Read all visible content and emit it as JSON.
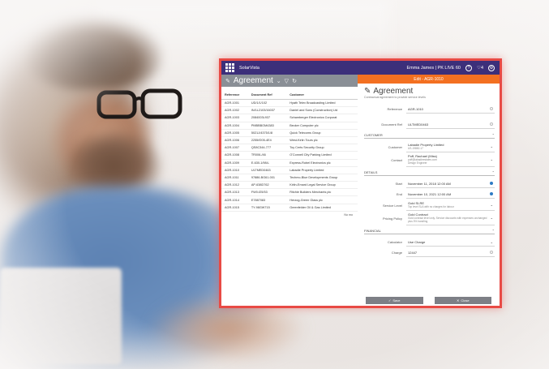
{
  "topbar": {
    "brand": "SolarVista",
    "user": "Emma James | PK LIVE 60",
    "notif_count": "4"
  },
  "list": {
    "title": "Agreement",
    "columns": [
      "Reference",
      "Document Ref",
      "Customer"
    ],
    "rows": [
      [
        "AGR-1001",
        "UD/1/1/102",
        "Hyath Telex Broadcasting Limited"
      ],
      [
        "AGR-1002",
        "IN/1L2103/16037",
        "Daniel and Sons (Construction) Ltd"
      ],
      [
        "AGR-1003",
        "2084003L937",
        "Schamberger Electronics Corporat"
      ],
      [
        "AGR-1004",
        "PMBBBOM4383",
        "Becker Computer plc"
      ],
      [
        "AGR-1005",
        "5021J/4375/1/8",
        "Quick Telecoms Group"
      ],
      [
        "AGR-1006",
        "2255/f205-4E4",
        "West-Kiriin Tours plc"
      ],
      [
        "AGR-1007",
        "QS8C344-777",
        "Toy Certs Security Group"
      ],
      [
        "AGR-1008",
        "TR006-/46",
        "O'Connell City Parking Limited"
      ],
      [
        "AGR-1009",
        "E-630-1/984-",
        "Express-Robel Electronics plc"
      ],
      [
        "AGR-1010",
        "ULTMED0463",
        "Labadie Property Limited"
      ],
      [
        "AGR-1011",
        "97886-BG61-001",
        "Techmo-Blue Developments Group"
      ],
      [
        "AGR-1012",
        "AP-638D762",
        "Kirlin-Emard Legal Service Group"
      ],
      [
        "AGR-1013",
        "FW0-f25/53",
        "Ritchie Builders Merchants plc"
      ],
      [
        "AGR-1014",
        "E7887083",
        "Herzog-Green Glass plc"
      ],
      [
        "AGR-1015",
        "TY-98GW715",
        "Greenfelder Oil & Gas Limited"
      ]
    ],
    "more_text": "No mo"
  },
  "detail": {
    "header": "Edit - AGR-1010",
    "title": "Agreement",
    "subtitle": "Contractual agreement to provide service levels",
    "reference_label": "Reference",
    "reference_value": "AGR-1010",
    "docref_label": "Document Ref",
    "docref_value": "ULTMED0463",
    "customer_section": "CUSTOMER",
    "customer_label": "Customer",
    "customer_value": "Labadie Property Limited",
    "customer_sub": "US-19882-17",
    "contact_label": "Contact",
    "contact_value": "Poff, Rachael (Miss)",
    "contact_sub1": "poff@labadieestates.com",
    "contact_sub2": "Design Engineer",
    "details_section": "DETAILS",
    "start_label": "Start",
    "start_value": "November 11, 2018 12:00 AM",
    "end_label": "End",
    "end_value": "November 10, 2021 12:00 AM",
    "service_label": "Service Level",
    "service_value": "Gold SLRE",
    "service_sub": "Top level SLA with no charges for labour",
    "pricing_label": "Pricing Policy",
    "pricing_value": "Gold Contract",
    "pricing_sub": "Gold contract level only. Service discounts with expenses unchanged plus 5% handling",
    "financial_section": "FINANCIAL",
    "calc_label": "Calculator",
    "calc_value": "Use Charge",
    "charge_label": "Charge",
    "charge_value": "12447",
    "save_label": "Save",
    "close_label": "Close"
  },
  "colors": {
    "topbar": "#3c2f7a",
    "accent": "#f37021",
    "border": "#e84a45"
  }
}
